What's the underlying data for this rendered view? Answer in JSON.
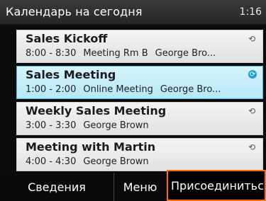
{
  "header": {
    "title": "Календарь на сегодня",
    "time": "1:16"
  },
  "meetings": [
    {
      "subject": "Sales Kickoff",
      "time": "8:00 - 8:30",
      "location": "Meeting Rm B",
      "organizer": "George Bro...",
      "sync_icon": "sync-icon"
    },
    {
      "subject": "Sales Meeting",
      "time": "1:00 - 2:00",
      "location": "Online Meeting",
      "organizer": "George Bro...",
      "sync_icon": "sync-icon",
      "selected": true
    },
    {
      "subject": "Weekly Sales Meeting",
      "time": "3:00 - 3:30",
      "location": "",
      "organizer": "George Brown",
      "sync_icon": "sync-icon"
    },
    {
      "subject": "Meeting with Martin",
      "time": "4:00 - 4:30",
      "location": "",
      "organizer": "George Brown",
      "sync_icon": "sync-icon"
    }
  ],
  "softkeys": {
    "left": "Сведения",
    "middle": "Меню",
    "right": "Присоединиться"
  },
  "colors": {
    "selection": "#b6e7f7",
    "selection_border": "#4ab7dd",
    "focus": "#ff6d00"
  }
}
